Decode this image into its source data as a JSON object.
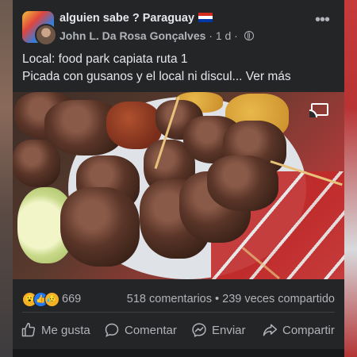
{
  "post": {
    "group_name": "alguien sabe ? Paraguay",
    "group_flag_emoji": "🇵🇾",
    "author": "John L. Da Rosa Gonçalves",
    "time_separator": " · 1 d · ",
    "text_line_1": "Local: food park capiata ruta 1",
    "text_line_2": "Picada con gusanos y el local ni discul...",
    "see_more": "Ver más",
    "more_icon": "more-horizontal-icon"
  },
  "media": {
    "icon": "cast-icon"
  },
  "stats": {
    "reaction_icons": [
      "wow-reaction-icon",
      "like-reaction-icon",
      "sad-reaction-icon"
    ],
    "reaction_count": "669",
    "comments_and_shares": "518 comentarios • 239 veces compartido"
  },
  "actions": {
    "like": "Me gusta",
    "comment": "Comentar",
    "send": "Enviar",
    "share": "Compartir"
  },
  "colors": {
    "card_bg": "#242526",
    "text_primary": "#e4e6eb",
    "text_secondary": "#b0b3b8",
    "like_blue": "#2078f4",
    "reaction_yellow": "#f7b125"
  }
}
